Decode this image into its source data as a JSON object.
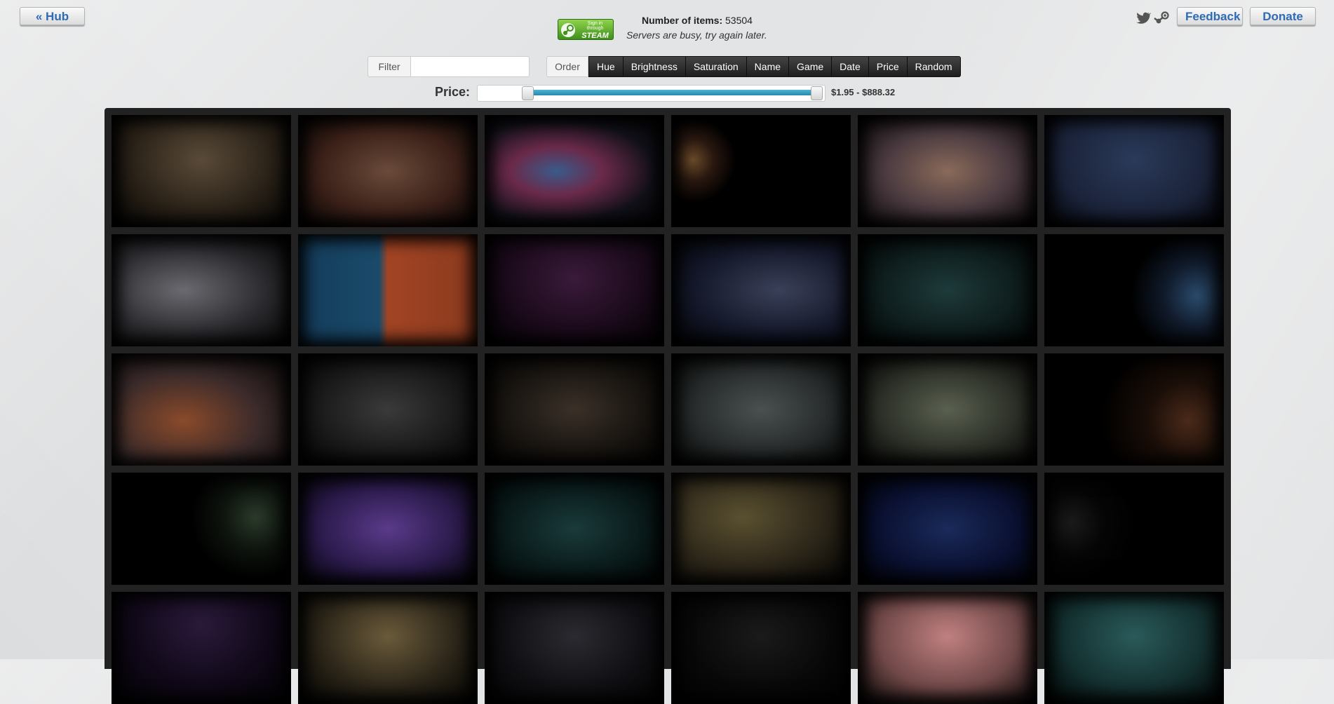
{
  "header": {
    "hub_label": "« Hub",
    "feedback_label": "Feedback",
    "donate_label": "Donate",
    "signin": {
      "line1": "Sign in through",
      "line2": "STEAM"
    },
    "items_label": "Number of items:",
    "items_count": "53504",
    "status": "Servers are busy, try again later."
  },
  "controls": {
    "filter_label": "Filter",
    "filter_value": "",
    "order_label": "Order",
    "order_options": [
      "Hue",
      "Brightness",
      "Saturation",
      "Name",
      "Game",
      "Date",
      "Price",
      "Random"
    ],
    "price_label": "Price:",
    "price_range": "$1.95 - $888.32",
    "price_min_fraction": 0.0,
    "price_max_fraction": 1.0
  },
  "colors": {
    "link_blue": "#2e6bb5",
    "slider_fill": "#3aa0c6",
    "steam_green": "#5fae2e"
  },
  "gallery": {
    "tiles": [
      {
        "name": "forest-fog",
        "bg": "radial-gradient(ellipse at 50% 40%, #5a4a38 0%, #2a2218 55%, #000 100%)"
      },
      {
        "name": "anime-mech-girl",
        "bg": "radial-gradient(ellipse at 50% 50%, #6a4a3a 0%, #3a2018 55%, #000 100%)"
      },
      {
        "name": "nebula-splash",
        "bg": "radial-gradient(ellipse at 40% 50%, #3a5a8a 0%, #6a2a4a 30%, #101018 65%, #000 100%)"
      },
      {
        "name": "character-emblem",
        "bg": "radial-gradient(circle at 12% 40%, #6a4a2a 0%, #2a1810 12%, #000 25%)"
      },
      {
        "name": "chinatown-street",
        "bg": "radial-gradient(ellipse at 50% 50%, #8a6a5a 0%, #4a3a40 50%, #000 100%)"
      },
      {
        "name": "blue-pixel-room",
        "bg": "radial-gradient(ellipse at 50% 40%, #2a3a5a 0%, #1a2238 60%, #000 100%)"
      },
      {
        "name": "photo-collage",
        "bg": "radial-gradient(ellipse at 40% 50%, #6a6a70 0%, #2a2a2e 55%, #000 100%)"
      },
      {
        "name": "blue-orange-split",
        "bg": "linear-gradient(90deg, #143c5a 0%, #1a4a6a 45%, #a24424 50%, #8a3a1e 100%)"
      },
      {
        "name": "red-hair-girls",
        "bg": "radial-gradient(ellipse at 50% 40%, #3a1a3a 0%, #1a0a1a 55%, #000 100%)"
      },
      {
        "name": "white-hair-girls",
        "bg": "radial-gradient(ellipse at 60% 50%, #3a4058 0%, #14182a 55%, #000 100%)"
      },
      {
        "name": "dark-alley",
        "bg": "radial-gradient(ellipse at 50% 50%, #1e3a3a 0%, #0e1c1c 55%, #000 100%)"
      },
      {
        "name": "mermaid",
        "bg": "radial-gradient(circle at 85% 55%, #2a4a6a 0%, #101a2a 20%, #000 40%)"
      },
      {
        "name": "fire-battle",
        "bg": "radial-gradient(ellipse at 40% 60%, #8a4a2a 0%, #3a2a2a 50%, #000 100%)"
      },
      {
        "name": "chalk-monsters",
        "bg": "radial-gradient(ellipse at 50% 50%, #3a3a3a 0%, #1a1a1a 55%, #000 100%)"
      },
      {
        "name": "dark-fantasy-girls",
        "bg": "radial-gradient(ellipse at 50% 50%, #3a3028 0%, #181410 55%, #000 100%)"
      },
      {
        "name": "rainy-race",
        "bg": "radial-gradient(ellipse at 50% 50%, #4a5050 0%, #262a2a 55%, #000 100%)"
      },
      {
        "name": "night-city",
        "bg": "radial-gradient(ellipse at 50% 50%, #5a6050 0%, #2a2e26 55%, #000 100%)"
      },
      {
        "name": "red-bikini-girl",
        "bg": "radial-gradient(circle at 80% 60%, #4a2a1a 0%, #1a0e08 25%, #000 55%)"
      },
      {
        "name": "skull-emblem",
        "bg": "radial-gradient(circle at 80% 40%, #2a3a2a 0%, #0e140e 20%, #000 40%)"
      },
      {
        "name": "purple-skeletons",
        "bg": "radial-gradient(ellipse at 50% 50%, #5a3a8a 0%, #2a1a4a 55%, #000 100%)"
      },
      {
        "name": "neon-signs",
        "bg": "radial-gradient(ellipse at 50% 50%, #1a3a3a 0%, #0a1a1a 55%, #000 100%)"
      },
      {
        "name": "goalie-mask",
        "bg": "radial-gradient(ellipse at 40% 40%, #5a5030 0%, #2a2418 55%, #000 100%)"
      },
      {
        "name": "lanterns",
        "bg": "radial-gradient(ellipse at 50% 50%, #1a2a5a 0%, #0a1030 55%, #000 100%)"
      },
      {
        "name": "sketch-figure",
        "bg": "radial-gradient(circle at 15% 45%, #1a1a1a 0%, #050505 20%, #000 40%)"
      },
      {
        "name": "horned-girl",
        "bg": "radial-gradient(ellipse at 50% 30%, #2a1a3a 0%, #100818 55%, #000 100%)"
      },
      {
        "name": "steampunk",
        "bg": "radial-gradient(ellipse at 50% 40%, #6a5a3a 0%, #2a2418 55%, #000 100%)"
      },
      {
        "name": "dark-wires",
        "bg": "radial-gradient(ellipse at 50% 40%, #2a2a30 0%, #101014 55%, #000 100%)"
      },
      {
        "name": "grey-figures",
        "bg": "radial-gradient(ellipse at 50% 40%, #1a1a1a 0%, #080808 55%, #000 100%)"
      },
      {
        "name": "anime-group",
        "bg": "radial-gradient(ellipse at 50% 40%, #c08080 0%, #704848 55%, #000 100%)"
      },
      {
        "name": "green-masks",
        "bg": "radial-gradient(ellipse at 50% 40%, #2a5a5a 0%, #143030 55%, #000 100%)"
      }
    ]
  }
}
